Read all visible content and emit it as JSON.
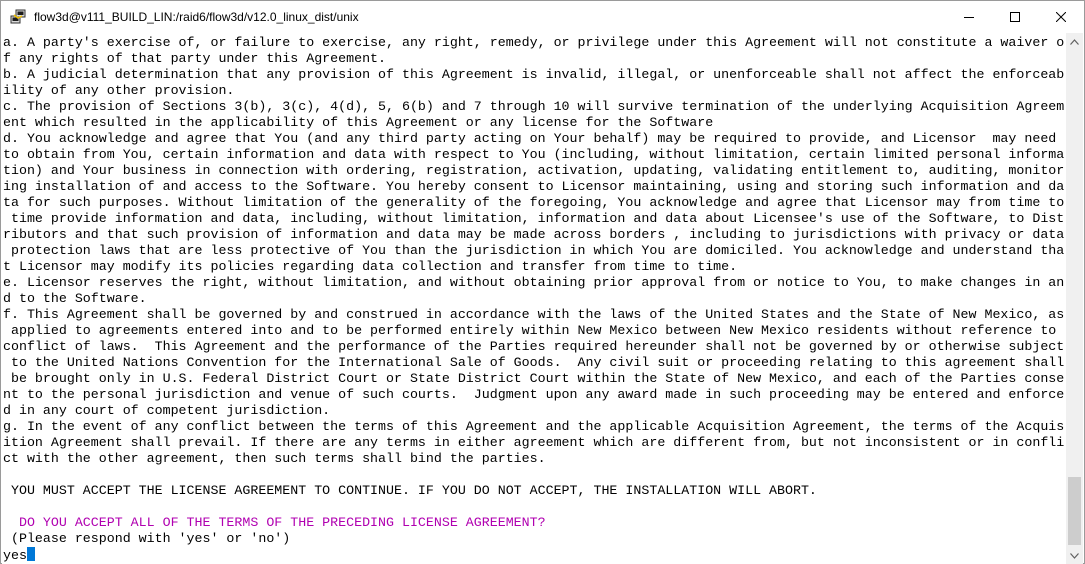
{
  "window": {
    "title": "flow3d@v111_BUILD_LIN:/raid6/flow3d/v12.0_linux_dist/unix",
    "app_icon": "putty-icon",
    "controls": [
      "minimize-icon",
      "maximize-icon",
      "close-icon"
    ]
  },
  "terminal": {
    "lines": [
      "a. A party's exercise of, or failure to exercise, any right, remedy, or privilege under this Agreement will not constitute a waiver o",
      "f any rights of that party under this Agreement.",
      "b. A judicial determination that any provision of this Agreement is invalid, illegal, or unenforceable shall not affect the enforceab",
      "ility of any other provision.",
      "c. The provision of Sections 3(b), 3(c), 4(d), 5, 6(b) and 7 through 10 will survive termination of the underlying Acquisition Agreem",
      "ent which resulted in the applicability of this Agreement or any license for the Software",
      "d. You acknowledge and agree that You (and any third party acting on Your behalf) may be required to provide, and Licensor  may need",
      "to obtain from You, certain information and data with respect to You (including, without limitation, certain limited personal informa",
      "tion) and Your business in connection with ordering, registration, activation, updating, validating entitlement to, auditing, monitor",
      "ing installation of and access to the Software. You hereby consent to Licensor maintaining, using and storing such information and da",
      "ta for such purposes. Without limitation of the generality of the foregoing, You acknowledge and agree that Licensor may from time to",
      " time provide information and data, including, without limitation, information and data about Licensee's use of the Software, to Dist",
      "ributors and that such provision of information and data may be made across borders , including to jurisdictions with privacy or data",
      " protection laws that are less protective of You than the jurisdiction in which You are domiciled. You acknowledge and understand tha",
      "t Licensor may modify its policies regarding data collection and transfer from time to time.",
      "e. Licensor reserves the right, without limitation, and without obtaining prior approval from or notice to You, to make changes in an",
      "d to the Software.",
      "f. This Agreement shall be governed by and construed in accordance with the laws of the United States and the State of New Mexico, as",
      " applied to agreements entered into and to be performed entirely within New Mexico between New Mexico residents without reference to",
      "conflict of laws.  This Agreement and the performance of the Parties required hereunder shall not be governed by or otherwise subject",
      " to the United Nations Convention for the International Sale of Goods.  Any civil suit or proceeding relating to this agreement shall",
      " be brought only in U.S. Federal District Court or State District Court within the State of New Mexico, and each of the Parties conse",
      "nt to the personal jurisdiction and venue of such courts.  Judgment upon any award made in such proceeding may be entered and enforce",
      "d in any court of competent jurisdiction.",
      "g. In the event of any conflict between the terms of this Agreement and the applicable Acquisition Agreement, the terms of the Acquis",
      "ition Agreement shall prevail. If there are any terms in either agreement which are different from, but not inconsistent or in confli",
      "ct with the other agreement, then such terms shall bind the parties.",
      "",
      " YOU MUST ACCEPT THE LICENSE AGREEMENT TO CONTINUE. IF YOU DO NOT ACCEPT, THE INSTALLATION WILL ABORT.",
      ""
    ],
    "prompt": "  DO YOU ACCEPT ALL OF THE TERMS OF THE PRECEDING LICENSE AGREEMENT?",
    "hint": " (Please respond with 'yes' or 'no')",
    "input_value": "yes",
    "prompt_color": "#b000b0",
    "cursor_color": "#0078d7"
  }
}
